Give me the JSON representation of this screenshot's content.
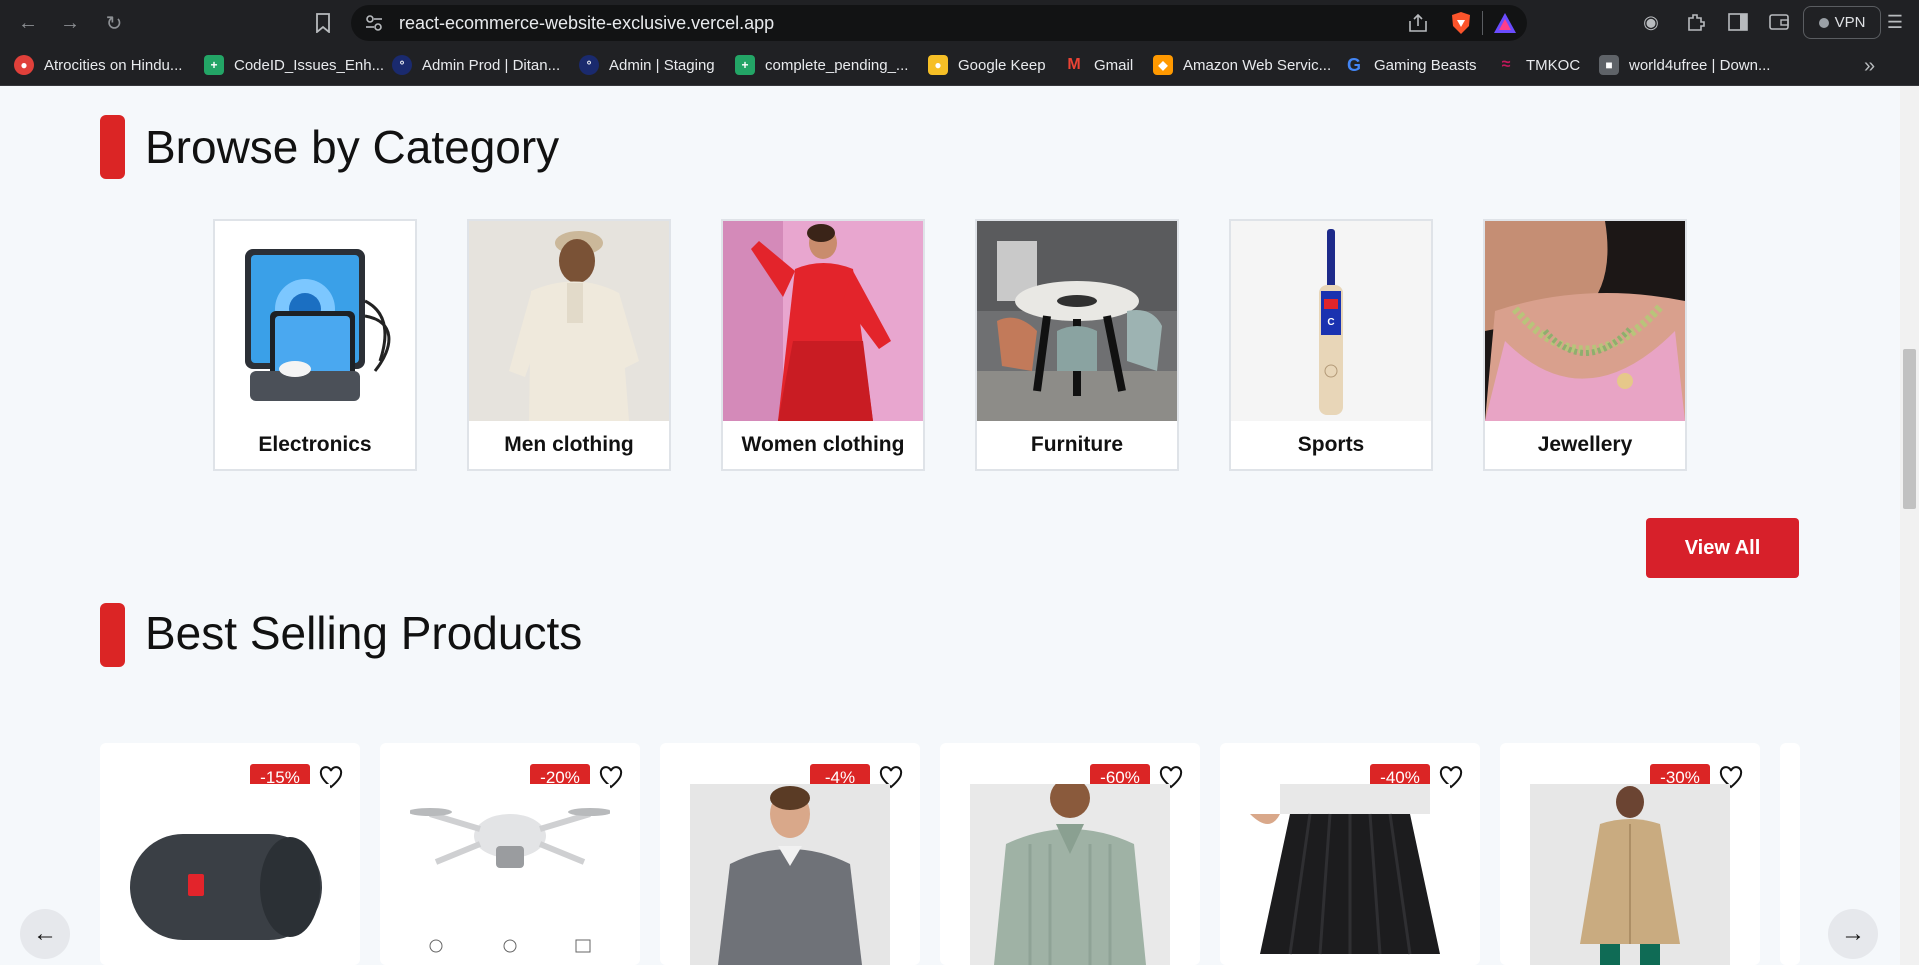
{
  "browser": {
    "url": "react-ecommerce-website-exclusive.vercel.app",
    "vpn_label": "VPN",
    "nav_icons": [
      "back-icon",
      "forward-icon",
      "reload-icon",
      "bookmark-icon"
    ],
    "bookmarks": [
      {
        "label": "Atrocities on Hindu...",
        "icon": "site-favicon",
        "color": "#e0403a"
      },
      {
        "label": "CodeID_Issues_Enh...",
        "icon": "sheets-icon",
        "color": "#23a566"
      },
      {
        "label": "Admin Prod | Ditan...",
        "icon": "site-favicon",
        "color": "#3b5ccc"
      },
      {
        "label": "Admin | Staging",
        "icon": "site-favicon",
        "color": "#3b5ccc"
      },
      {
        "label": "complete_pending_...",
        "icon": "sheets-icon",
        "color": "#23a566"
      },
      {
        "label": "Google Keep",
        "icon": "keep-icon",
        "color": "#f6bf26"
      },
      {
        "label": "Gmail",
        "icon": "gmail-icon",
        "color": "#ea4335"
      },
      {
        "label": "Amazon Web Servic...",
        "icon": "aws-icon",
        "color": "#ff9900"
      },
      {
        "label": "Gaming Beasts",
        "icon": "g-icon",
        "color": "#4285f4"
      },
      {
        "label": "TMKOC",
        "icon": "site-favicon",
        "color": "#c2185b"
      },
      {
        "label": "world4ufree | Down...",
        "icon": "site-favicon",
        "color": "#888888"
      }
    ]
  },
  "browse": {
    "title": "Browse by Category",
    "categories": [
      {
        "label": "Electronics"
      },
      {
        "label": "Men clothing"
      },
      {
        "label": "Women clothing"
      },
      {
        "label": "Furniture"
      },
      {
        "label": "Sports"
      },
      {
        "label": "Jewellery"
      }
    ]
  },
  "best_selling": {
    "title": "Best Selling Products",
    "view_all_label": "View All",
    "products": [
      {
        "discount": "-15%",
        "image": "bluetooth-speaker"
      },
      {
        "discount": "-20%",
        "image": "drone"
      },
      {
        "discount": "-4%",
        "image": "grey-sweater"
      },
      {
        "discount": "-60%",
        "image": "green-polo-shirt"
      },
      {
        "discount": "-40%",
        "image": "black-pleated-skirt"
      },
      {
        "discount": "-30%",
        "image": "beige-trench-coat"
      }
    ]
  },
  "colors": {
    "accent": "#db2525",
    "chrome_bg": "#202124",
    "page_bg": "#f5f8fb"
  }
}
